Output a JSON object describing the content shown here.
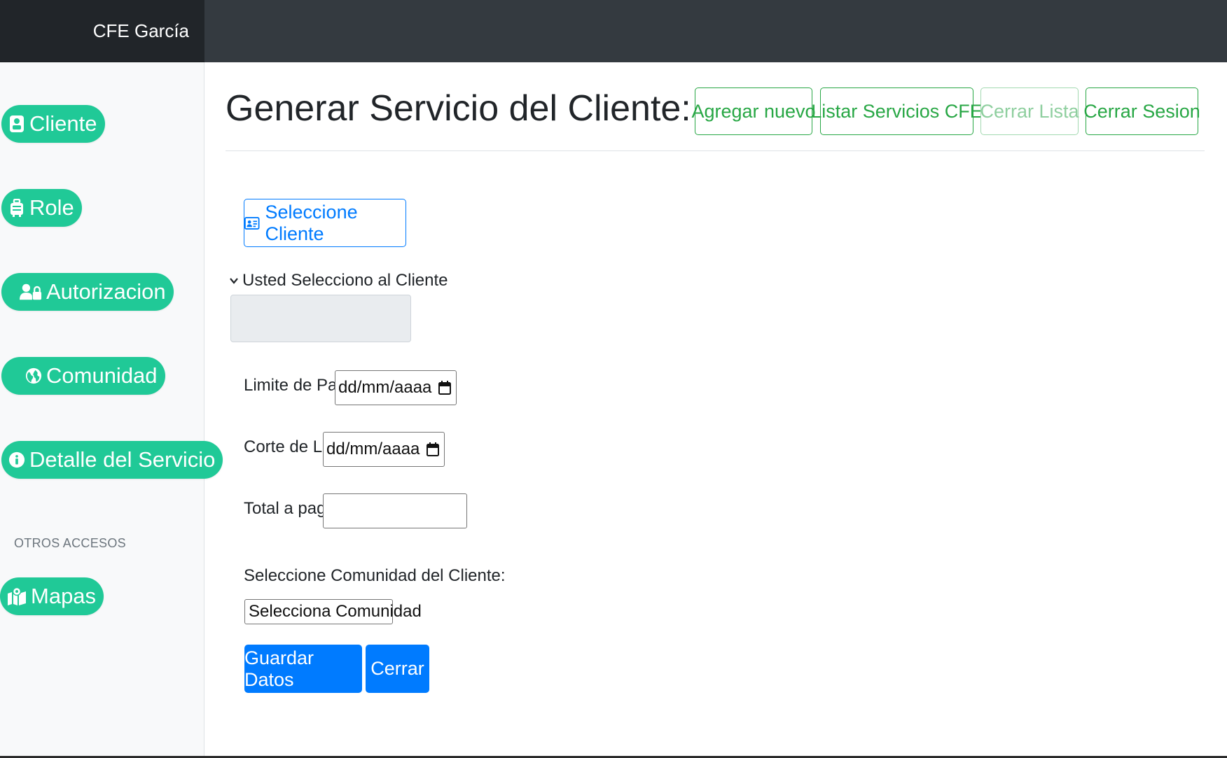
{
  "navbar": {
    "brand": "CFE García"
  },
  "sidebar": {
    "items": [
      {
        "label": "Cliente",
        "icon": "id-card-icon"
      },
      {
        "label": "Role",
        "icon": "suitcase-icon"
      },
      {
        "label": "Autorizacion",
        "icon": "user-lock-icon"
      },
      {
        "label": "Comunidad",
        "icon": "globe-icon"
      },
      {
        "label": "Detalle del Servicio",
        "icon": "info-circle-icon"
      }
    ],
    "section_heading": "OTROS ACCESOS",
    "extra_items": [
      {
        "label": "Mapas",
        "icon": "map-marked-icon"
      }
    ],
    "button_color": "#20c997"
  },
  "main": {
    "title": "Generar Servicio del Cliente:",
    "top_buttons": [
      {
        "label": "Agregar nuevo"
      },
      {
        "label": "Listar Servicios CFE"
      },
      {
        "label": "Cerrar Lista",
        "disabled": true
      },
      {
        "label": "Cerrar Sesion"
      }
    ],
    "select_client_button": "Seleccione Cliente",
    "selected_client_summary": "Usted Selecciono al Cliente",
    "selected_client_value": "",
    "fields": {
      "limite_pago": {
        "label": "Limite de Pago:",
        "value": "dd/mm/aaaa"
      },
      "corte_luz": {
        "label": "Corte de Luz:",
        "value": "dd/mm/aaaa"
      },
      "total_pagar": {
        "label": "Total a pagar:",
        "value": ""
      },
      "comunidad": {
        "label": "Seleccione Comunidad del Cliente:",
        "selected": "Selecciona Comunidad"
      }
    },
    "actions": {
      "save": "Guardar Datos",
      "close": "Cerrar"
    }
  },
  "colors": {
    "navbar": "#343a40",
    "brand_bg": "#212529",
    "success": "#28a745",
    "primary": "#007bff",
    "sidebar_bg": "#f8f9fa"
  }
}
